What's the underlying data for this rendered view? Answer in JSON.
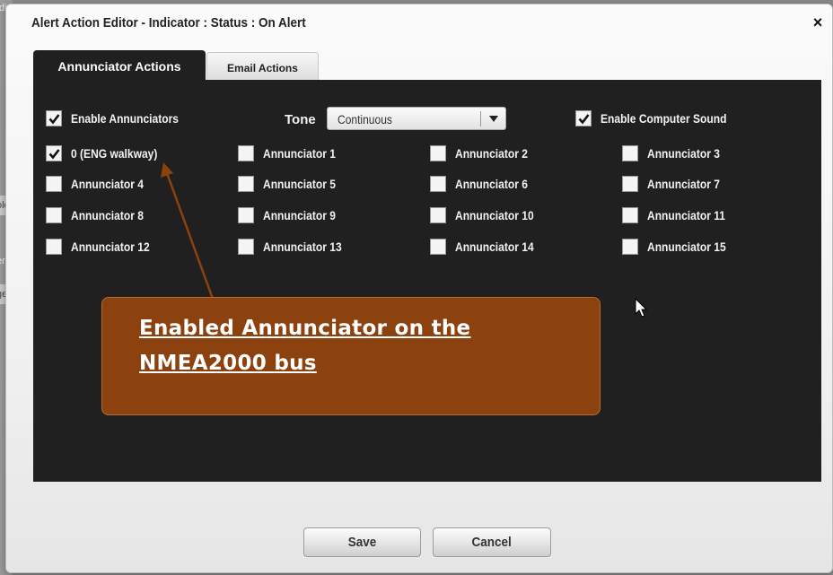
{
  "background": {
    "fragments": [
      ":di",
      "ole",
      "era",
      "ge"
    ]
  },
  "dialog": {
    "title": "Alert Action Editor  - Indicator : Status : On Alert",
    "close_label": "×"
  },
  "tabs": [
    {
      "label": "Annunciator Actions",
      "active": true
    },
    {
      "label": "Email Actions",
      "active": false
    }
  ],
  "controls": {
    "enable_annunciators": {
      "label": "Enable Annunciators",
      "checked": true
    },
    "tone": {
      "label": "Tone",
      "value": "Continuous"
    },
    "enable_computer_sound": {
      "label": "Enable Computer Sound",
      "checked": true
    }
  },
  "annunciators": [
    {
      "label": "0 (ENG walkway)",
      "checked": true
    },
    {
      "label": "Annunciator 1",
      "checked": false
    },
    {
      "label": "Annunciator 2",
      "checked": false
    },
    {
      "label": "Annunciator 3",
      "checked": false
    },
    {
      "label": "Annunciator 4",
      "checked": false
    },
    {
      "label": "Annunciator 5",
      "checked": false
    },
    {
      "label": "Annunciator 6",
      "checked": false
    },
    {
      "label": "Annunciator 7",
      "checked": false
    },
    {
      "label": "Annunciator 8",
      "checked": false
    },
    {
      "label": "Annunciator 9",
      "checked": false
    },
    {
      "label": "Annunciator 10",
      "checked": false
    },
    {
      "label": "Annunciator 11",
      "checked": false
    },
    {
      "label": "Annunciator 12",
      "checked": false
    },
    {
      "label": "Annunciator 13",
      "checked": false
    },
    {
      "label": "Annunciator 14",
      "checked": false
    },
    {
      "label": "Annunciator 15",
      "checked": false
    }
  ],
  "annotation": {
    "text": "Enabled Annunciator on the\nNMEA2000 bus",
    "color": "#8b420f"
  },
  "buttons": {
    "save": "Save",
    "cancel": "Cancel"
  },
  "colors": {
    "panel": "#202020",
    "accent": "#8b420f",
    "dialog": "#f1f1f1"
  }
}
